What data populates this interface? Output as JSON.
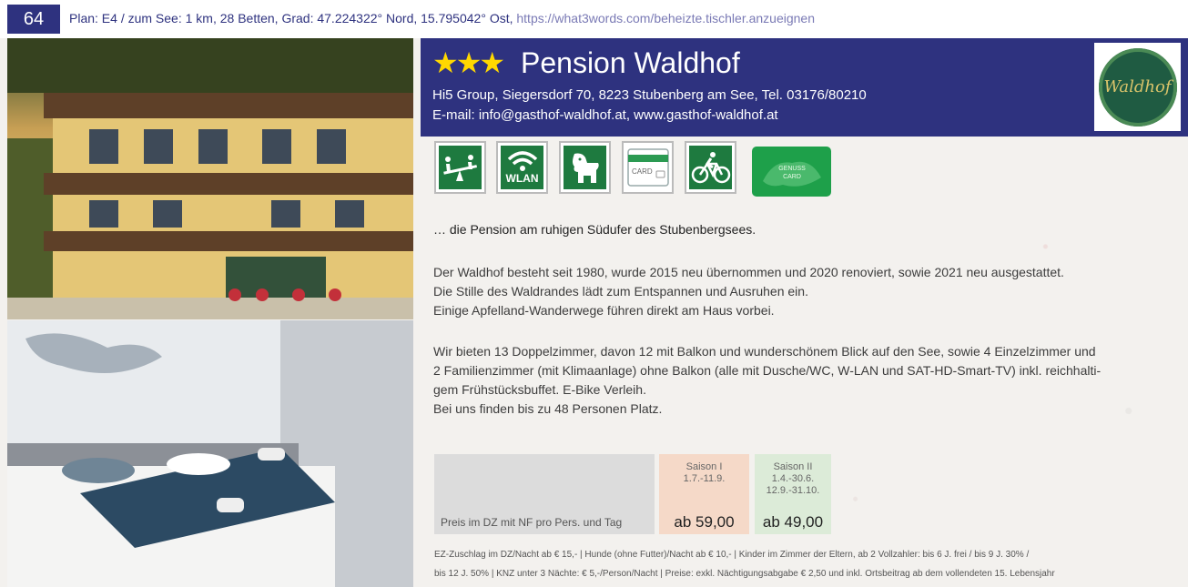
{
  "page_number": "64",
  "info_line": "Plan: E4 / zum See: 1 km, 28 Betten, Grad: 47.224322° Nord, 15.795042° Ost,",
  "info_url": "https://what3words.com/beheizte.tischler.anzueignen",
  "header": {
    "stars": "★★★",
    "name": "Pension Waldhof",
    "address": "Hi5 Group, Siegersdorf 70, 8223 Stubenberg am See, Tel. 03176/80210",
    "contact": "E-mail: info@gasthof-waldhof.at, www.gasthof-waldhof.at",
    "logo_text": "Waldhof"
  },
  "amenities": [
    {
      "icon": "playground-icon"
    },
    {
      "icon": "wlan-icon",
      "label": "WLAN"
    },
    {
      "icon": "dog-icon"
    },
    {
      "icon": "card-icon",
      "label": "CARD"
    },
    {
      "icon": "bicycle-icon"
    },
    {
      "icon": "genusscard-icon",
      "label": "GENUSS CARD"
    }
  ],
  "tagline": "… die Pension am ruhigen Südufer des Stubenbergsees.",
  "paragraph1": [
    "Der Waldhof besteht seit 1980, wurde 2015 neu übernommen und 2020 renoviert, sowie 2021 neu ausgestattet.",
    "Die Stille des Waldrandes lädt zum Entspannen und Ausruhen ein.",
    "Einige Apfelland-Wanderwege führen direkt am Haus vorbei."
  ],
  "paragraph2": [
    "Wir bieten 13 Doppelzimmer, davon 12 mit Balkon und wunderschönem Blick auf den See, sowie 4 Einzelzimmer und",
    "2 Familienzimmer (mit Klimaanlage) ohne Balkon (alle mit Dusche/WC, W-LAN und SAT-HD-Smart-TV) inkl. reichhalti-",
    "gem Frühstücksbuffet. E-Bike Verleih.",
    "Bei uns finden bis zu 48 Personen Platz."
  ],
  "prices": {
    "label": "Preis im DZ mit NF pro Pers. und Tag",
    "season1": {
      "name": "Saison I",
      "dates": "1.7.-11.9.",
      "price": "ab 59,00"
    },
    "season2": {
      "name": "Saison II",
      "dates1": "1.4.-30.6.",
      "dates2": "12.9.-31.10.",
      "price": "ab 49,00"
    }
  },
  "footnotes": [
    "EZ-Zuschlag im DZ/Nacht ab € 15,- | Hunde (ohne Futter)/Nacht ab € 10,- | Kinder im Zimmer der Eltern, ab 2 Vollzahler: bis 6 J. frei / bis 9 J. 30% /",
    "bis 12 J. 50% | KNZ unter 3 Nächte: € 5,-/Person/Nacht | Preise: exkl. Nächtigungsabgabe € 2,50 und inkl. Ortsbeitrag ab dem vollendeten 15. Lebensjahr"
  ],
  "colors": {
    "brand": "#2e327f",
    "star": "#ffd800",
    "icon_green": "#1e7a3f"
  }
}
